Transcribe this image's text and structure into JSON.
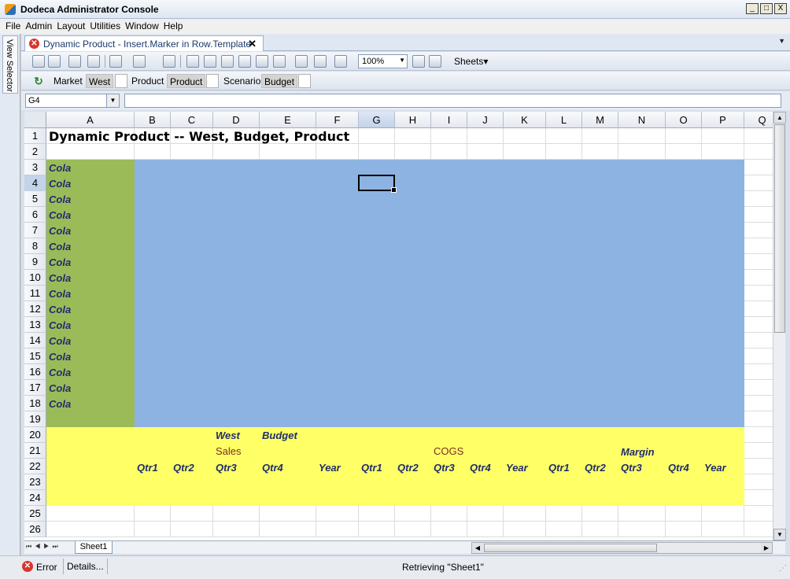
{
  "window": {
    "title": "Dodeca Administrator Console",
    "buttons": [
      "_",
      "□",
      "X"
    ]
  },
  "menu": [
    "File",
    "Admin",
    "Layout",
    "Utilities",
    "Window",
    "Help"
  ],
  "view_selector": {
    "label": "View Selector"
  },
  "document_tab": {
    "label": "Dynamic Product - Insert.Marker in Row.Template",
    "close": "✕",
    "dropdown": "▼"
  },
  "toolbar": {
    "zoom": "100%",
    "sheets_label": "Sheets",
    "sheets_arrow": "▾"
  },
  "selectors": [
    {
      "dimension": "Market",
      "value": "West"
    },
    {
      "dimension": "Product",
      "value": "Product"
    },
    {
      "dimension": "Scenario",
      "value": "Budget"
    }
  ],
  "formula_bar": {
    "cell_ref": "G4",
    "formula": ""
  },
  "grid": {
    "columns": [
      "A",
      "B",
      "C",
      "D",
      "E",
      "F",
      "G",
      "H",
      "I",
      "J",
      "K",
      "L",
      "M",
      "N",
      "O",
      "P",
      "Q"
    ],
    "selected_column": "G",
    "rows": [
      "1",
      "2",
      "3",
      "4",
      "5",
      "6",
      "7",
      "8",
      "9",
      "10",
      "11",
      "12",
      "13",
      "14",
      "15",
      "16",
      "17",
      "18",
      "19",
      "20",
      "21",
      "22",
      "23",
      "24",
      "25",
      "26"
    ],
    "selected_row": "4",
    "title": "Dynamic Product -- West, Budget, Product",
    "products": [
      "Cola",
      "Cola",
      "Cola",
      "Cola",
      "Cola",
      "Cola",
      "Cola",
      "Cola",
      "Cola",
      "Cola",
      "Cola",
      "Cola",
      "Cola",
      "Cola",
      "Cola",
      "Cola"
    ],
    "header_row20": {
      "market": "West",
      "scenario": "Budget"
    },
    "header_row21": {
      "sales": "Sales",
      "cogs": "COGS",
      "margin": "Margin"
    },
    "header_row22": [
      "Qtr1",
      "Qtr2",
      "Qtr3",
      "Qtr4",
      "Year",
      "Qtr1",
      "Qtr2",
      "Qtr3",
      "Qtr4",
      "Year",
      "Qtr1",
      "Qtr2",
      "Qtr3",
      "Qtr4",
      "Year"
    ],
    "colors": {
      "green": "#9bbb59",
      "blue": "#8db3e2",
      "yellow": "#ffff66",
      "header_text": "#1f2d6e",
      "measure_text": "#7b2d26"
    }
  },
  "sheet_tab": "Sheet1",
  "status": {
    "error": "Error",
    "details": "Details...",
    "message": "Retrieving \"Sheet1\""
  }
}
